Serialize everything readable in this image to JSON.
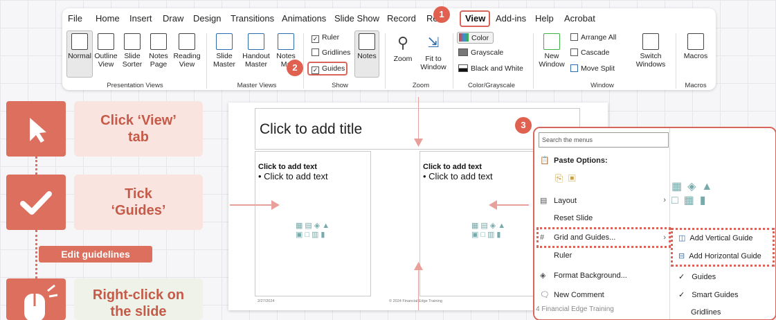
{
  "ribbon": {
    "tabs": [
      "File",
      "Home",
      "Insert",
      "Draw",
      "Design",
      "Transitions",
      "Animations",
      "Slide Show",
      "Record",
      "Re",
      "View",
      "Add-ins",
      "Help",
      "Acrobat"
    ],
    "groups": {
      "presentation_views": {
        "label": "Presentation Views",
        "buttons": [
          "Normal",
          "Outline View",
          "Slide Sorter",
          "Notes Page",
          "Reading View"
        ]
      },
      "master_views": {
        "label": "Master Views",
        "buttons": [
          "Slide Master",
          "Handout Master",
          "Notes Ma"
        ]
      },
      "show": {
        "label": "Show",
        "checks": [
          "Ruler",
          "Gridlines",
          "Guides"
        ],
        "notes": "Notes"
      },
      "zoom": {
        "label": "Zoom",
        "buttons": [
          "Zoom",
          "Fit to Window"
        ]
      },
      "color": {
        "label": "Color/Grayscale",
        "buttons": [
          "Color",
          "Grayscale",
          "Black and White"
        ]
      },
      "window": {
        "label": "Window",
        "new_window": "New Window",
        "buttons": [
          "Arrange All",
          "Cascade",
          "Move Split"
        ],
        "switch": "Switch Windows"
      },
      "macros": {
        "label": "Macros",
        "button": "Macros"
      }
    }
  },
  "badges": [
    "1",
    "2",
    "3"
  ],
  "steps": {
    "step1": "Click ‘View’ tab",
    "step2": "Tick ‘Guides’",
    "edit_tag": "Edit guidelines",
    "step3": "Right-click on the slide"
  },
  "slide": {
    "title": "Click to add title",
    "left_head": "Click to add text",
    "left_bullet": "• Click to add text",
    "right_head": "Click to add text",
    "right_bullet": "• Click to add text",
    "date": "2/27/2024",
    "footer": "© 2024 Financial Edge Training"
  },
  "context_menu": {
    "search_placeholder": "Search the menus",
    "paste_options": "Paste Options:",
    "items": [
      "Layout",
      "Reset Slide",
      "Grid and Guides...",
      "Ruler",
      "Format Background...",
      "New Comment"
    ],
    "submenu": [
      "Add Vertical Guide",
      "Add Horizontal Guide",
      "Guides",
      "Smart Guides",
      "Gridlines"
    ],
    "behind_text": "4 Financial Edge Training"
  },
  "colors": {
    "accent": "#dc6f5d",
    "card_pink": "#f9e4e0",
    "card_green": "#eef2e8"
  }
}
